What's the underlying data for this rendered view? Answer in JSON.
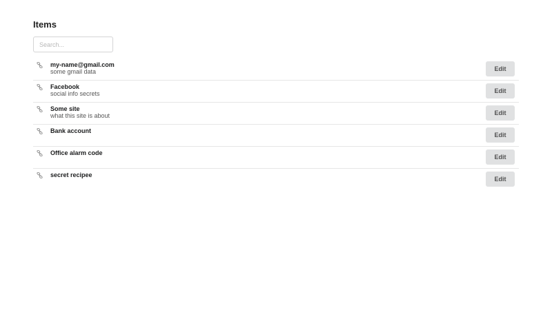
{
  "header": {
    "title": "Items"
  },
  "search": {
    "placeholder": "Search...",
    "value": ""
  },
  "items": [
    {
      "name": "my-name@gmail.com",
      "description": "some gmail data",
      "edit_label": "Edit"
    },
    {
      "name": "Facebook",
      "description": "social info secrets",
      "edit_label": "Edit"
    },
    {
      "name": "Some site",
      "description": "what this site is about",
      "edit_label": "Edit"
    },
    {
      "name": "Bank account",
      "description": "",
      "edit_label": "Edit"
    },
    {
      "name": "Office alarm code",
      "description": "",
      "edit_label": "Edit"
    },
    {
      "name": "secret recipee",
      "description": "",
      "edit_label": "Edit"
    }
  ],
  "icons": {
    "item_icon": "link-icon"
  }
}
